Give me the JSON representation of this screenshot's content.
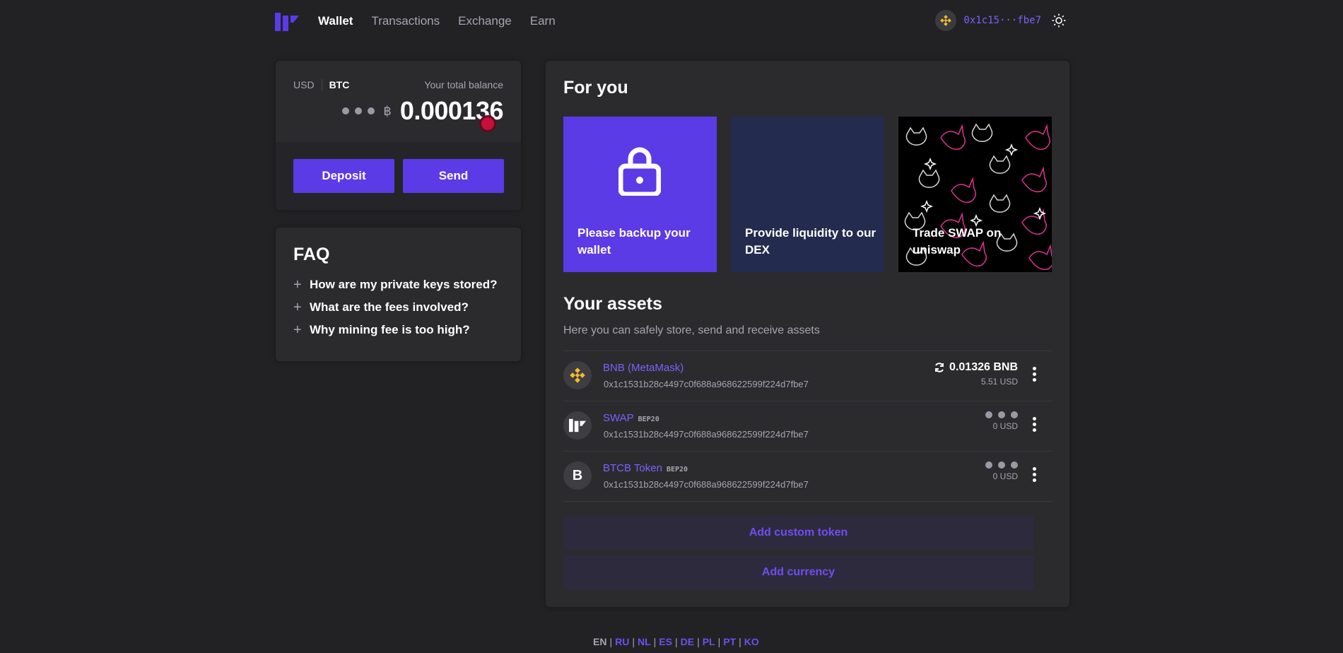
{
  "nav": {
    "items": [
      {
        "label": "Wallet",
        "active": true
      },
      {
        "label": "Transactions",
        "active": false
      },
      {
        "label": "Exchange",
        "active": false
      },
      {
        "label": "Earn",
        "active": false
      }
    ],
    "address_short": "0x1c15···fbe7",
    "network_icon": "bnb-icon",
    "theme_icon": "sun-icon"
  },
  "balance": {
    "currency_usd": "USD",
    "currency_btc": "BTC",
    "label": "Your total balance",
    "symbol": "฿",
    "value": "0.000136",
    "deposit_label": "Deposit",
    "send_label": "Send"
  },
  "faq": {
    "title": "FAQ",
    "items": [
      "How are my private keys stored?",
      "What are the fees involved?",
      "Why mining fee is too high?"
    ]
  },
  "for_you": {
    "title": "For you",
    "cards": [
      {
        "text": "Please backup your wallet",
        "icon": "lock-icon"
      },
      {
        "text": "Provide liquidity to our DEX"
      },
      {
        "text": "Trade SWAP on uniswap"
      }
    ]
  },
  "assets": {
    "title": "Your assets",
    "subtitle": "Here you can safely store, send and receive assets",
    "rows": [
      {
        "name": "BNB (MetaMask)",
        "standard": "",
        "address": "0x1c1531b28c4497c0f688a968622599f224d7fbe7",
        "amount": "0.01326 BNB",
        "usd": "5.51 USD",
        "icon": "bnb-icon"
      },
      {
        "name": "SWAP",
        "standard": "BEP20",
        "address": "0x1c1531b28c4497c0f688a968622599f224d7fbe7",
        "amount": "",
        "usd": "0 USD",
        "icon": "swap-logo-icon"
      },
      {
        "name": "BTCB Token",
        "standard": "BEP20",
        "address": "0x1c1531b28c4497c0f688a968622599f224d7fbe7",
        "amount": "",
        "usd": "0 USD",
        "icon_letter": "B"
      }
    ],
    "add_token_label": "Add custom token",
    "add_currency_label": "Add currency"
  },
  "languages": [
    "EN",
    "RU",
    "NL",
    "ES",
    "DE",
    "PL",
    "PT",
    "KO"
  ],
  "colors": {
    "accent": "#5b3be6",
    "background": "#222225",
    "card": "#2b2b2e"
  }
}
